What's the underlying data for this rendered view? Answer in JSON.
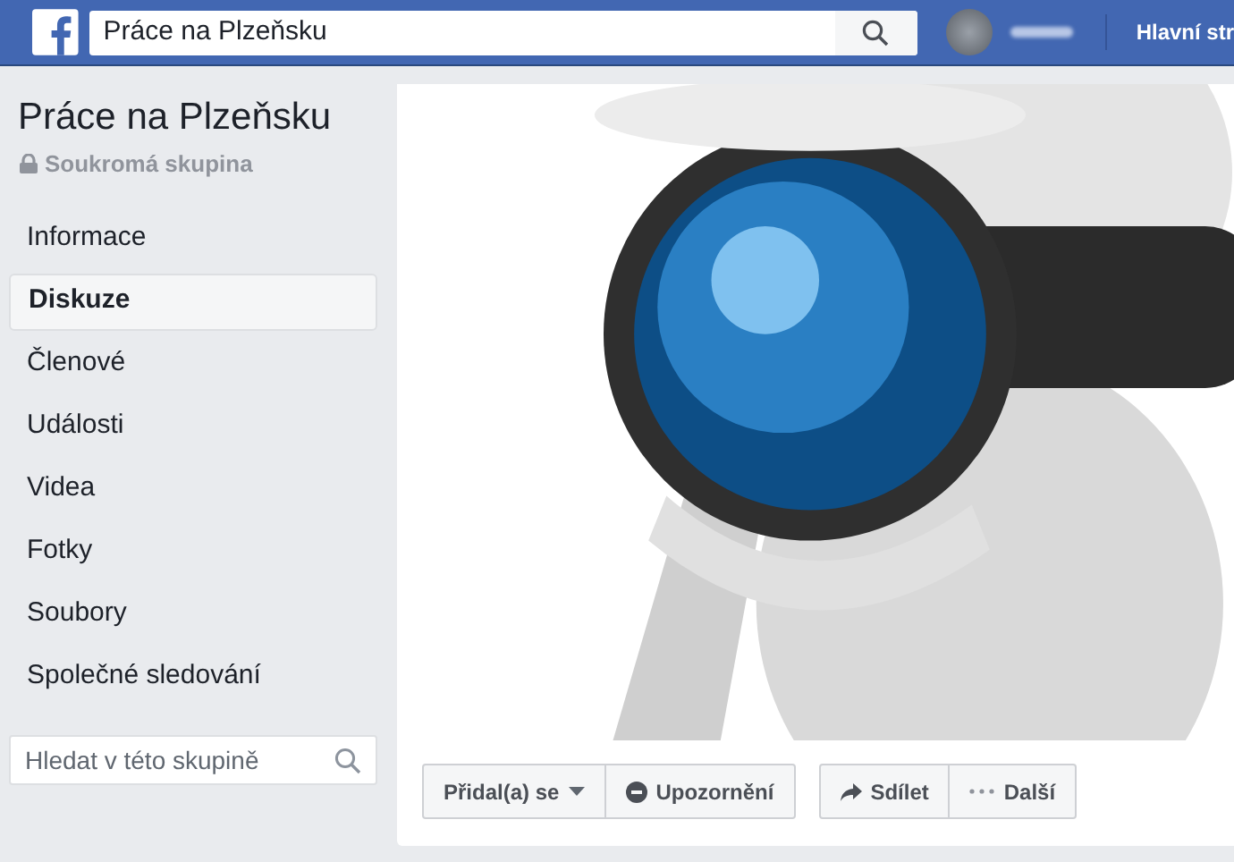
{
  "top_bar": {
    "search": {
      "value": "Práce na Plzeňsku"
    },
    "nav_link": "Hlavní str"
  },
  "group": {
    "name": "Práce na Plzeňsku",
    "privacy": "Soukromá skupina"
  },
  "sidebar": {
    "items": [
      {
        "label": "Informace",
        "selected": false
      },
      {
        "label": "Diskuze",
        "selected": true
      },
      {
        "label": "Členové",
        "selected": false
      },
      {
        "label": "Události",
        "selected": false
      },
      {
        "label": "Videa",
        "selected": false
      },
      {
        "label": "Fotky",
        "selected": false
      },
      {
        "label": "Soubory",
        "selected": false
      },
      {
        "label": "Společné sledování",
        "selected": false
      }
    ],
    "search": {
      "placeholder": "Hledat v této skupině"
    }
  },
  "actions": [
    [
      {
        "label": "Přidal(a) se",
        "kind": "dropdown"
      },
      {
        "label": "Upozornění",
        "kind": "notifications"
      }
    ],
    [
      {
        "label": "Sdílet",
        "kind": "share"
      },
      {
        "label": "Další",
        "kind": "more"
      }
    ]
  ]
}
